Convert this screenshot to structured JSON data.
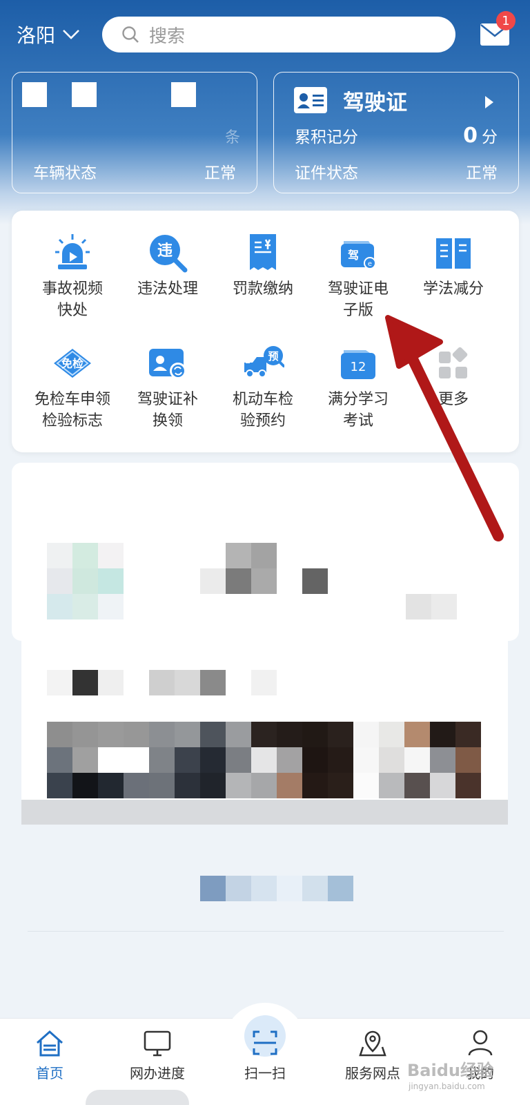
{
  "location": {
    "city": "洛阳"
  },
  "search": {
    "placeholder": "搜索"
  },
  "mail": {
    "unread": "1"
  },
  "vehicle_card": {
    "count_unit": "条",
    "status_label": "车辆状态",
    "status_value": "正常"
  },
  "license_card": {
    "title": "驾驶证",
    "points_label": "累积记分",
    "points_value": "0",
    "points_unit": "分",
    "status_label": "证件状态",
    "status_value": "正常"
  },
  "services": [
    {
      "label": "事故视频\n快处",
      "icon": "siren-icon"
    },
    {
      "label": "违法处理",
      "icon": "violation-search-icon"
    },
    {
      "label": "罚款缴纳",
      "icon": "fine-receipt-icon"
    },
    {
      "label": "驾驶证电\n子版",
      "icon": "e-license-wallet-icon"
    },
    {
      "label": "学法减分",
      "icon": "open-book-icon"
    },
    {
      "label": "免检车申领\n检验标志",
      "icon": "exempt-badge-icon"
    },
    {
      "label": "驾驶证补\n换领",
      "icon": "license-replace-icon"
    },
    {
      "label": "机动车检\n验预约",
      "icon": "truck-appointment-icon"
    },
    {
      "label": "满分学习\n考试",
      "icon": "calendar-12-icon"
    },
    {
      "label": "更多",
      "icon": "more-grid-icon"
    }
  ],
  "nav": [
    {
      "label": "首页",
      "icon": "home-icon",
      "active": true
    },
    {
      "label": "网办进度",
      "icon": "monitor-icon",
      "active": false
    },
    {
      "label": "扫一扫",
      "icon": "scan-icon",
      "active": false
    },
    {
      "label": "服务网点",
      "icon": "map-pin-icon",
      "active": false
    },
    {
      "label": "我的",
      "icon": "user-icon",
      "active": false
    }
  ],
  "watermark": {
    "brand": "Baidu经验",
    "url": "jingyan.baidu.com"
  },
  "colors": {
    "brand_blue": "#1d5ea8",
    "accent_blue": "#2f8ae5",
    "annotation_red": "#b01818",
    "badge_red": "#f04848"
  }
}
